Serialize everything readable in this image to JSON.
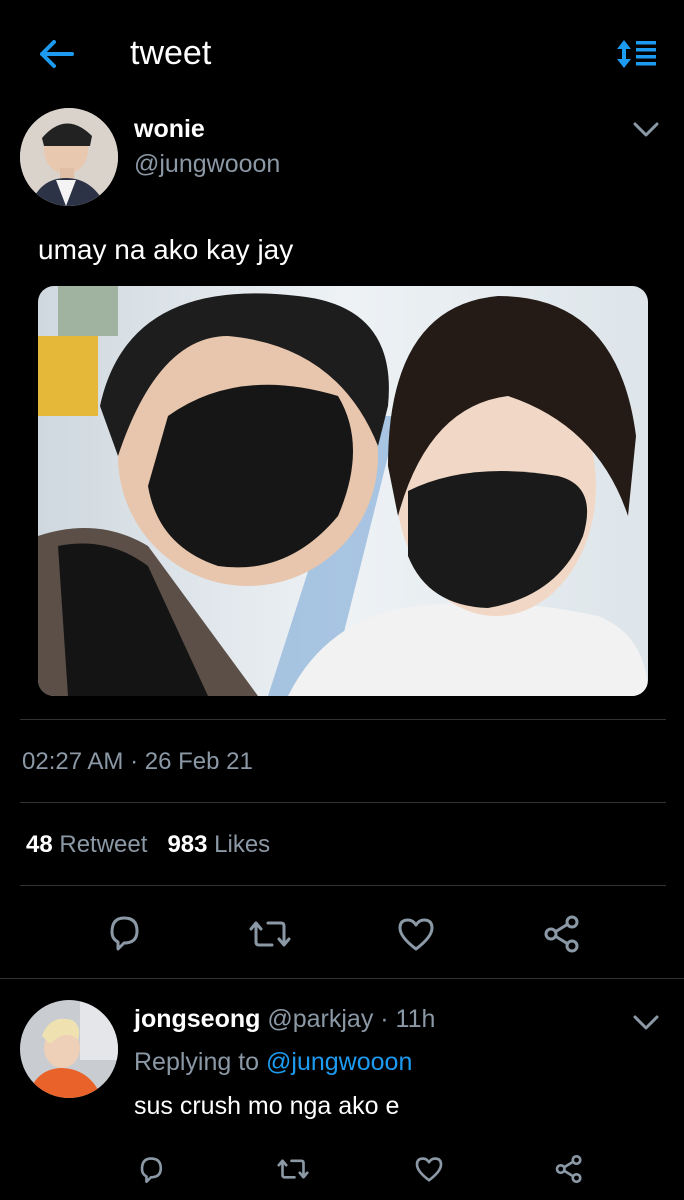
{
  "header": {
    "title": "tweet",
    "back_icon": "arrow-left-icon",
    "sort_icon": "sort-list-icon",
    "accent": "#1d9bf0"
  },
  "tweet": {
    "author_name": "wonie",
    "author_handle": "@jungwooon",
    "text": "umay na ako kay jay",
    "timestamp": "02:27 AM · 26 Feb 21",
    "retweet_count": "48",
    "retweet_label": "Retweet",
    "like_count": "983",
    "like_label": "Likes"
  },
  "actions": [
    "reply-icon",
    "retweet-icon",
    "like-icon",
    "share-icon"
  ],
  "reply": {
    "author_name": "jongseong",
    "author_handle": "@parkjay",
    "time": "· 11h",
    "replying_prefix": "Replying to",
    "replying_to": "@jungwooon",
    "text": "sus crush mo nga ako e"
  }
}
